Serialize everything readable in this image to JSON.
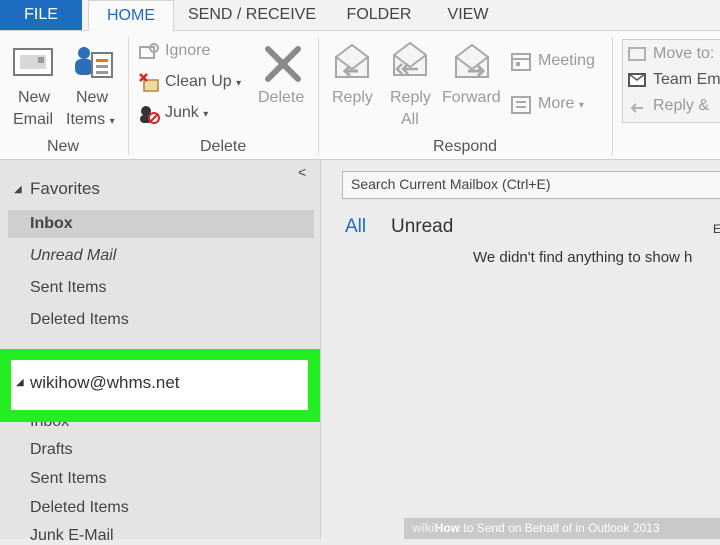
{
  "tabs": {
    "file": "FILE",
    "home": "HOME",
    "send_receive": "SEND / RECEIVE",
    "folder": "FOLDER",
    "view": "VIEW"
  },
  "ribbon": {
    "new_email": [
      "New",
      "Email"
    ],
    "new_items": [
      "New",
      "Items"
    ],
    "group_new": "New",
    "ignore": "Ignore",
    "clean_up": "Clean Up",
    "junk": "Junk",
    "delete": "Delete",
    "group_delete": "Delete",
    "reply": "Reply",
    "reply_all": [
      "Reply",
      "All"
    ],
    "forward": "Forward",
    "meeting": "Meeting",
    "more": "More",
    "group_respond": "Respond",
    "quick_steps": {
      "move_to": "Move to:",
      "team_email": "Team Em",
      "reply_delete": "Reply &"
    }
  },
  "folders": {
    "favorites": "Favorites",
    "fav_items": [
      "Inbox",
      "Unread Mail",
      "Sent Items",
      "Deleted Items"
    ],
    "account": "wikihow@whms.net",
    "account_items": [
      "Inbox",
      "Drafts",
      "Sent Items",
      "Deleted Items",
      "Junk E-Mail"
    ]
  },
  "content": {
    "search_placeholder": "Search Current Mailbox (Ctrl+E)",
    "filter_all": "All",
    "filter_unread": "Unread",
    "empty_message": "We didn't find anything to show h"
  },
  "watermark": {
    "brand": "wiki",
    "brand_bold": "How",
    "text": " to Send on Behalf of in Outlook 2013"
  },
  "colors": {
    "accent": "#1e6cbf",
    "highlight": "#22ee22"
  }
}
